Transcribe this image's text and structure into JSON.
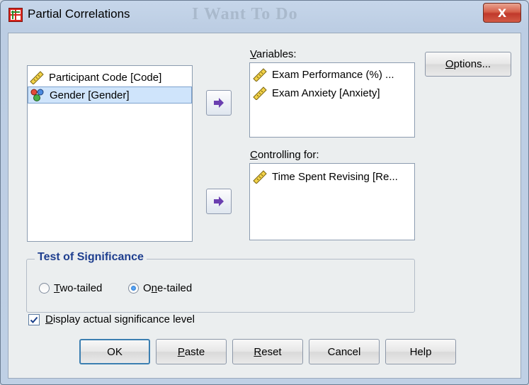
{
  "window": {
    "title": "Partial Correlations",
    "background_watermark": "I Want To Do",
    "close_label": "X"
  },
  "source_list": {
    "items": [
      {
        "label": "Participant Code [Code]",
        "icon": "scale-ruler-icon",
        "selected": false
      },
      {
        "label": "Gender [Gender]",
        "icon": "nominal-people-icon",
        "selected": true
      }
    ]
  },
  "variables": {
    "label": "Variables:",
    "items": [
      {
        "label": "Exam Performance (%) ...",
        "icon": "scale-ruler-icon"
      },
      {
        "label": "Exam Anxiety [Anxiety]",
        "icon": "scale-ruler-icon"
      }
    ]
  },
  "controlling": {
    "label": "Controlling for:",
    "items": [
      {
        "label": "Time Spent Revising [Re...",
        "icon": "scale-ruler-icon"
      }
    ]
  },
  "options_button": "Options...",
  "test_of_significance": {
    "title": "Test of Significance",
    "two_tailed": "Two-tailed",
    "one_tailed": "One-tailed",
    "selected": "one-tailed"
  },
  "display_actual": {
    "label": "Display actual significance level",
    "checked": true
  },
  "buttons": {
    "ok": "OK",
    "paste": "Paste",
    "reset": "Reset",
    "cancel": "Cancel",
    "help": "Help"
  },
  "colors": {
    "group_title": "#1f3f8f",
    "selected_row": "#cfe4fb",
    "close_button": "#c0392b"
  }
}
